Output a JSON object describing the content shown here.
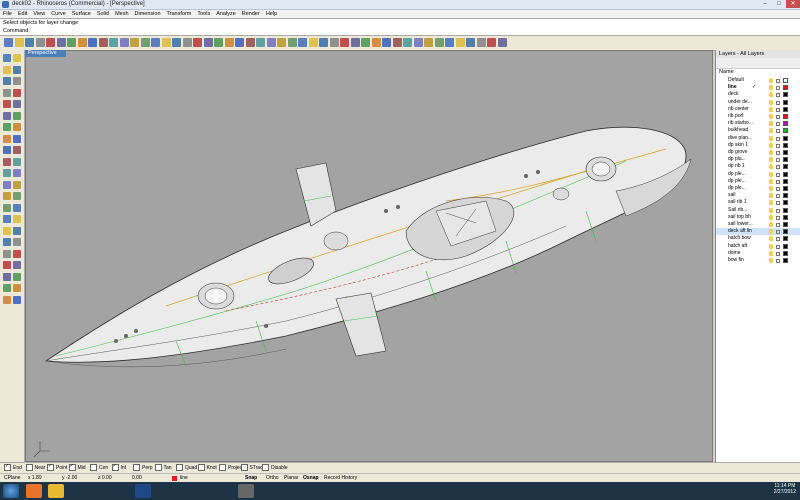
{
  "window": {
    "title": "deck02 - Rhinoceros (Commercial) - [Perspective]"
  },
  "menu": [
    "File",
    "Edit",
    "View",
    "Curve",
    "Surface",
    "Solid",
    "Mesh",
    "Dimension",
    "Transform",
    "Tools",
    "Analyze",
    "Render",
    "Help"
  ],
  "command": {
    "history": "Select objects for layer change",
    "prompt": "Command:"
  },
  "viewport": {
    "label": "Perspective"
  },
  "layers_panel": {
    "title": "Layers - All Layers",
    "column_header": "Name",
    "rows": [
      {
        "name": "Default",
        "color": "#ffffff",
        "current": false
      },
      {
        "name": "line",
        "color": "#ff0000",
        "current": true
      },
      {
        "name": "deck",
        "color": "#000000",
        "current": false
      },
      {
        "name": "under de...",
        "color": "#000000",
        "current": false
      },
      {
        "name": "rib center",
        "color": "#000000",
        "current": false
      },
      {
        "name": "rib port",
        "color": "#ff0000",
        "current": false
      },
      {
        "name": "rib starbo...",
        "color": "#c000c0",
        "current": false
      },
      {
        "name": "bulkhead",
        "color": "#00c000",
        "current": false
      },
      {
        "name": "dive plan...",
        "color": "#000000",
        "current": false
      },
      {
        "name": "dp skin 1",
        "color": "#000000",
        "current": false
      },
      {
        "name": "dp grove",
        "color": "#000000",
        "current": false
      },
      {
        "name": "dp pla...",
        "color": "#000000",
        "current": false
      },
      {
        "name": "dp rib 1",
        "color": "#000000",
        "current": false
      },
      {
        "name": "dp ple...",
        "color": "#000000",
        "current": false
      },
      {
        "name": "dp ple...",
        "color": "#000000",
        "current": false
      },
      {
        "name": "dp ple...",
        "color": "#000000",
        "current": false
      },
      {
        "name": "sail",
        "color": "#000000",
        "current": false
      },
      {
        "name": "sail rib 1",
        "color": "#000000",
        "current": false
      },
      {
        "name": "Sail rib...",
        "color": "#000000",
        "current": false
      },
      {
        "name": "sail top bh",
        "color": "#000000",
        "current": false
      },
      {
        "name": "sail lower...",
        "color": "#000000",
        "current": false
      },
      {
        "name": "deck aft lin",
        "color": "#000000",
        "current": false,
        "selected": true
      },
      {
        "name": "hatch bow",
        "color": "#000000",
        "current": false
      },
      {
        "name": "hatch aft",
        "color": "#000000",
        "current": false
      },
      {
        "name": "dome",
        "color": "#000000",
        "current": false
      },
      {
        "name": "bow fin",
        "color": "#000000",
        "current": false
      }
    ]
  },
  "osnaps": [
    {
      "label": "End",
      "on": true
    },
    {
      "label": "Near",
      "on": false
    },
    {
      "label": "Point",
      "on": true
    },
    {
      "label": "Mid",
      "on": true
    },
    {
      "label": "Cen",
      "on": false
    },
    {
      "label": "Int",
      "on": true
    },
    {
      "label": "Perp",
      "on": false
    },
    {
      "label": "Tan",
      "on": false
    },
    {
      "label": "Quad",
      "on": false
    },
    {
      "label": "Knot",
      "on": false
    },
    {
      "label": "Project",
      "on": false
    },
    {
      "label": "STrack",
      "on": false
    },
    {
      "label": "Disable",
      "on": false
    }
  ],
  "status": {
    "cplane": "CPlane",
    "x": "x 1.89",
    "y": "y -2.00",
    "z": "z 0.00",
    "dist": "0.00",
    "layer": "line",
    "toggles": [
      "Snap",
      "Ortho",
      "Planar",
      "Osnap",
      "Record History"
    ]
  },
  "clock": {
    "time": "11:14 PM",
    "date": "2/27/2012"
  },
  "icons": [
    "firefox-icon",
    "explorer-icon",
    "photoshop-icon",
    "rhino-icon"
  ]
}
